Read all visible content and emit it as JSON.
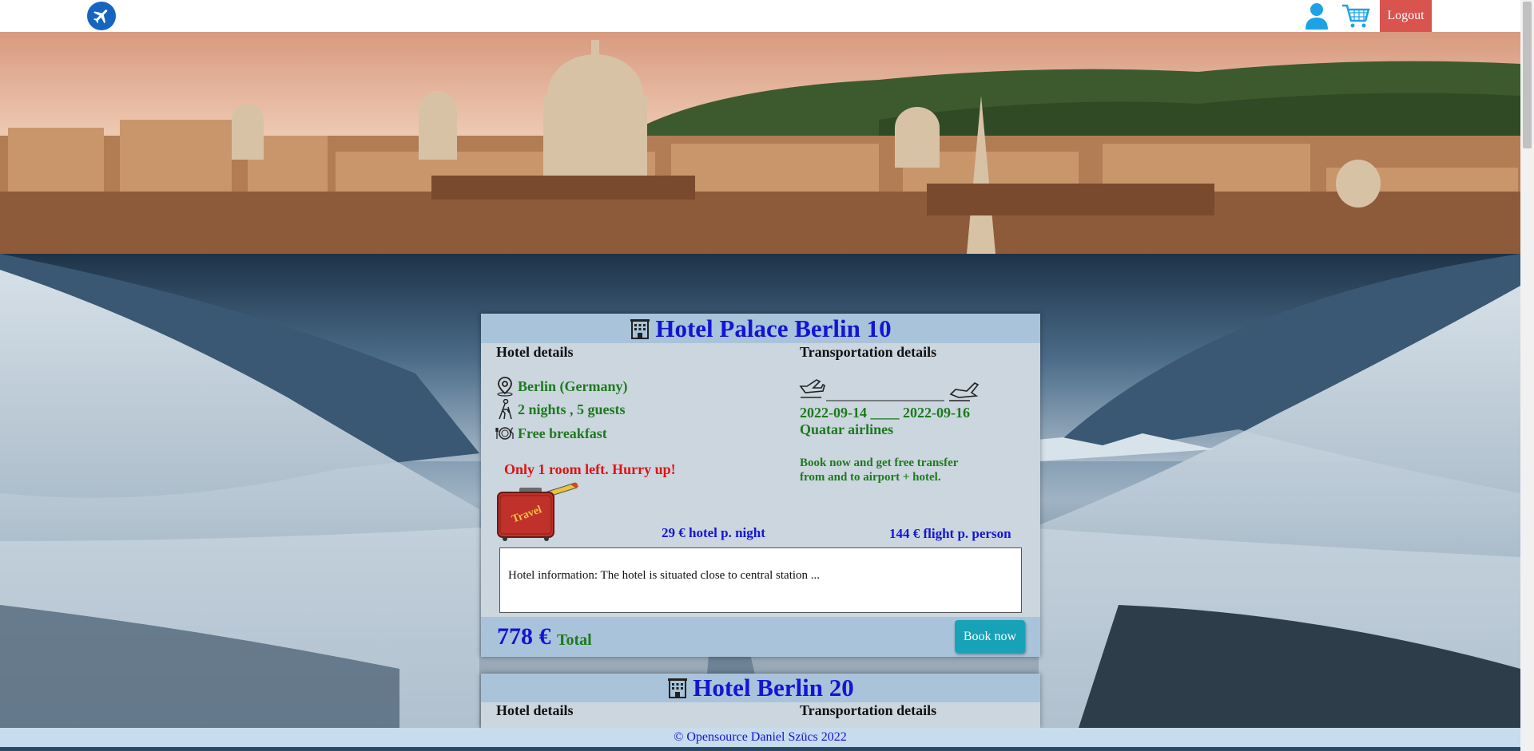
{
  "nav": {
    "logo_icon": "airplane-icon",
    "user_icon": "user-icon",
    "cart_icon": "cart-icon",
    "logout_label": "Logout"
  },
  "cards": [
    {
      "title": "Hotel Palace Berlin 10",
      "hotel_details_label": "Hotel details",
      "transport_details_label": "Transportation details",
      "location": "Berlin (Germany)",
      "stay": "2 nights , 5 guests",
      "meal": "Free breakfast",
      "urgency": "Only 1 room left. Hurry up!",
      "suitcase_text": "Travel",
      "dates": "2022-09-14 ____ 2022-09-16",
      "airline": "Quatar airlines",
      "promo": "Book now and get free transfer from and to airport + hotel.",
      "price_night": "29 € hotel p. night",
      "price_flight": "144 € flight p. person",
      "info": "Hotel information: The hotel is situated close to central station ...",
      "total_amount": "778 €",
      "total_label": "Total",
      "book_label": "Book now"
    },
    {
      "title": "Hotel Berlin 20",
      "hotel_details_label": "Hotel details",
      "transport_details_label": "Transportation details"
    }
  ],
  "footer": {
    "text": "© Opensource Daniel Szücs 2022"
  },
  "colors": {
    "accent_blue": "#1414d6",
    "accent_green": "#1d7a1d",
    "urgency_red": "#e31111",
    "logout_red": "#d9534f",
    "book_teal": "#17a2b8",
    "card_header": "#a9c4da",
    "card_body": "#cbd6df"
  }
}
